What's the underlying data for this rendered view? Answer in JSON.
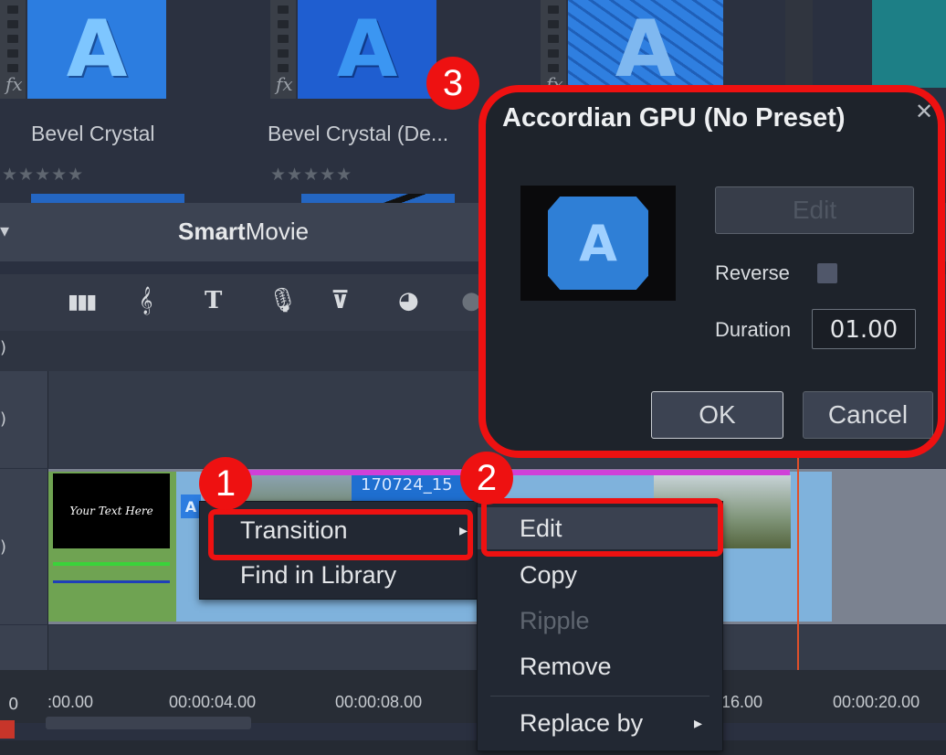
{
  "library": {
    "items": [
      {
        "label": "Bevel Crystal",
        "stars": "★★★★★"
      },
      {
        "label": "Bevel Crystal (De...",
        "stars": "★★★★★"
      }
    ],
    "fx_glyph": "fx",
    "thumb_letter": "A"
  },
  "smartmovie": {
    "title_bold": "Smart",
    "title_rest": "Movie"
  },
  "toolbar": {
    "icons": [
      "audio-levels-icon",
      "treble-clef-icon",
      "title-icon",
      "microphone-icon",
      "transition-icon",
      "color-icon"
    ]
  },
  "timeline": {
    "clip_text": "Your Text Here",
    "clip_name": "170724_15",
    "ruler": {
      "zero": "0",
      "ticks": [
        ":00.00",
        "00:00:04.00",
        "00:00:08.00",
        "16.00",
        "00:00:20.00"
      ]
    }
  },
  "context_menu": {
    "items": [
      {
        "label": "Transition",
        "submenu": true
      },
      {
        "label": "Find in Library"
      }
    ],
    "arrow": "▸"
  },
  "sub_menu": {
    "items": [
      {
        "label": "Edit",
        "enabled": true
      },
      {
        "label": "Copy",
        "enabled": true
      },
      {
        "label": "Ripple",
        "enabled": false
      },
      {
        "label": "Remove",
        "enabled": true
      },
      {
        "label": "Replace by",
        "enabled": true,
        "submenu": true
      }
    ]
  },
  "dialog": {
    "title": "Accordian GPU (No Preset)",
    "close": "✕",
    "edit_label": "Edit",
    "reverse_label": "Reverse",
    "duration_label": "Duration",
    "duration_value": "01.00",
    "ok_label": "OK",
    "cancel_label": "Cancel",
    "preview_letter": "A"
  },
  "badges": {
    "one": "1",
    "two": "2",
    "three": "3"
  },
  "colors": {
    "highlight": "#ee1111",
    "magenta_bar": "#d040d8",
    "accent_blue": "#2466c2"
  }
}
